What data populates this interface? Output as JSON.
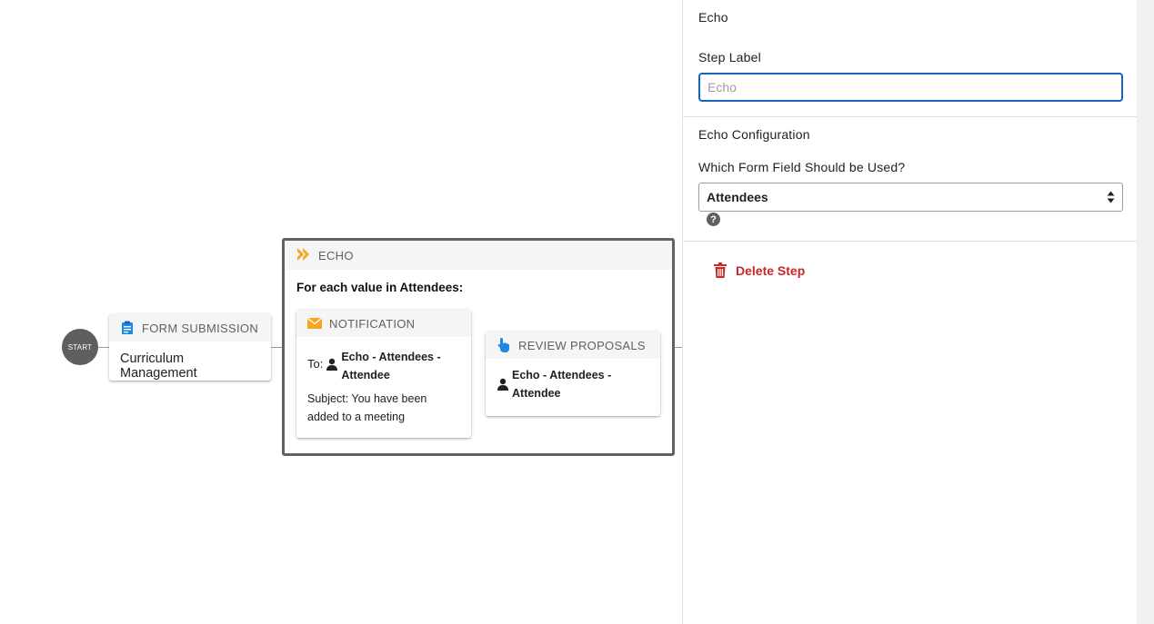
{
  "flow": {
    "start_label": "START",
    "form_submission": {
      "header": "FORM SUBMISSION",
      "body": "Curriculum Management",
      "icon": "clipboard-icon"
    },
    "echo": {
      "header": "ECHO",
      "icon": "double-chevron-icon",
      "loop_text": "For each value in Attendees:",
      "notification": {
        "header": "NOTIFICATION",
        "icon": "envelope-icon",
        "to_label": "To:",
        "recipient": "Echo - Attendees - Attendee",
        "subject": "Subject: You have been added to a meeting"
      },
      "review": {
        "header": "REVIEW PROPOSALS",
        "icon": "hand-pointer-icon",
        "assignee": "Echo - Attendees - Attendee"
      }
    }
  },
  "panel": {
    "title": "Echo",
    "step_label": "Step Label",
    "step_label_placeholder": "Echo",
    "step_label_value": "",
    "echo_configuration": "Echo Configuration",
    "which_field_label": "Which Form Field Should be Used?",
    "selected_field": "Attendees",
    "help_glyph": "?",
    "delete_step": "Delete Step"
  },
  "colors": {
    "accent_blue": "#1565c0",
    "delete_red": "#c62828",
    "echo_orange": "#f5a623",
    "icon_blue": "#1e88e5",
    "selected_border": "#616161"
  }
}
